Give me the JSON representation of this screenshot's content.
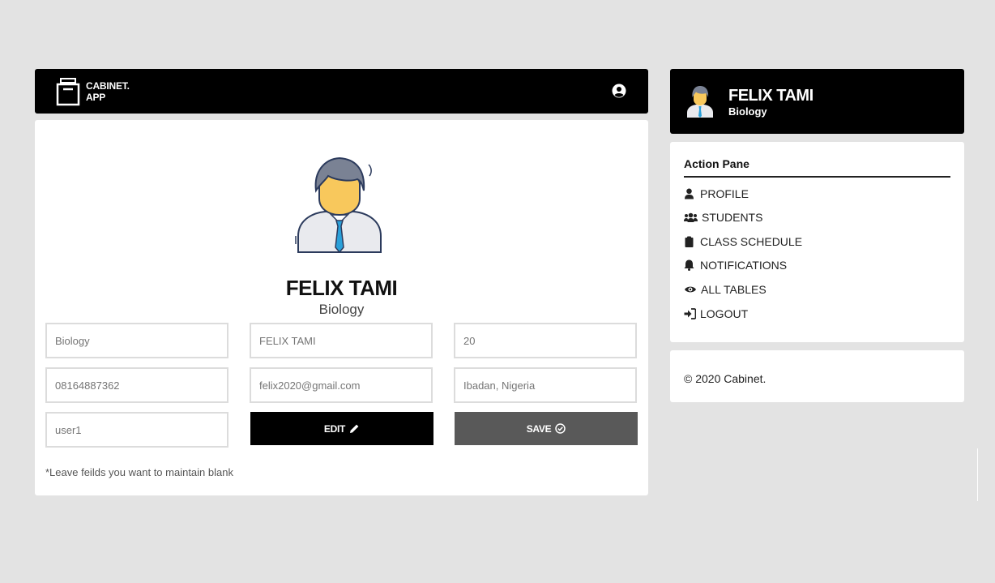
{
  "brand": {
    "line1": "CABINET.",
    "line2": "APP",
    "icon": "archive-box-icon"
  },
  "header": {
    "user_icon": "user-circle-icon"
  },
  "profile": {
    "name": "FELIX TAMI",
    "subject": "Biology",
    "avatar": "teacher-avatar-icon"
  },
  "form": {
    "fields": [
      {
        "name": "subject-field",
        "placeholder": "Biology"
      },
      {
        "name": "fullname-field",
        "placeholder": "FELIX TAMI"
      },
      {
        "name": "age-field",
        "placeholder": "20"
      },
      {
        "name": "phone-field",
        "placeholder": "08164887362"
      },
      {
        "name": "email-field",
        "placeholder": "felix2020@gmail.com"
      },
      {
        "name": "location-field",
        "placeholder": "Ibadan, Nigeria"
      },
      {
        "name": "username-field",
        "placeholder": "user1"
      }
    ],
    "edit_label": "EDIT",
    "save_label": "SAVE",
    "note": "*Leave feilds you want to maintain blank"
  },
  "sidebar": {
    "name": "FELIX TAMI",
    "subject": "Biology",
    "menu_title": "Action Pane",
    "items": [
      {
        "label": "PROFILE",
        "icon": "user-icon"
      },
      {
        "label": "STUDENTS",
        "icon": "users-icon"
      },
      {
        "label": "CLASS SCHEDULE",
        "icon": "clipboard-icon"
      },
      {
        "label": "NOTIFICATIONS",
        "icon": "bell-icon"
      },
      {
        "label": "ALL TABLES",
        "icon": "eye-icon"
      },
      {
        "label": "LOGOUT",
        "icon": "sign-in-icon"
      }
    ]
  },
  "footer": {
    "copyright": "© 2020 Cabinet."
  },
  "colors": {
    "bar": "#000000",
    "save_button": "#595959",
    "background": "#e3e3e3"
  }
}
